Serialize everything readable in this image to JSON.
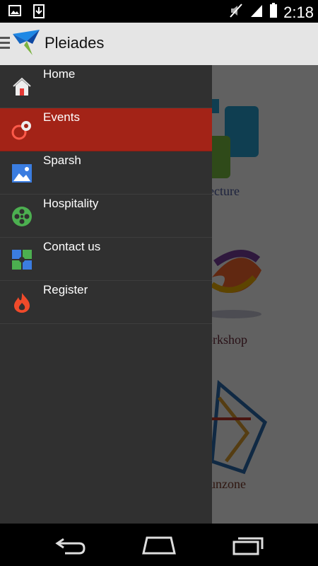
{
  "status_bar": {
    "time": "2:18"
  },
  "app": {
    "title": "Pleiades"
  },
  "background_tiles": [
    {
      "label": "ecture",
      "color": "#4a5aa0"
    },
    {
      "label": "orkshop",
      "color": "#6a2a3a"
    },
    {
      "label": "unzone",
      "color": "#7a3a2a"
    }
  ],
  "drawer": {
    "items": [
      {
        "label": "Home",
        "icon": "home-icon"
      },
      {
        "label": "Events",
        "icon": "events-icon",
        "active": true
      },
      {
        "label": "Sparsh",
        "icon": "image-icon"
      },
      {
        "label": "Hospitality",
        "icon": "film-reel-icon"
      },
      {
        "label": "Contact us",
        "icon": "puzzle-icon"
      },
      {
        "label": "Register",
        "icon": "flame-icon"
      }
    ]
  },
  "colors": {
    "active": "#a32317",
    "drawer_bg": "#303030",
    "action_bar": "#e5e5e5"
  }
}
